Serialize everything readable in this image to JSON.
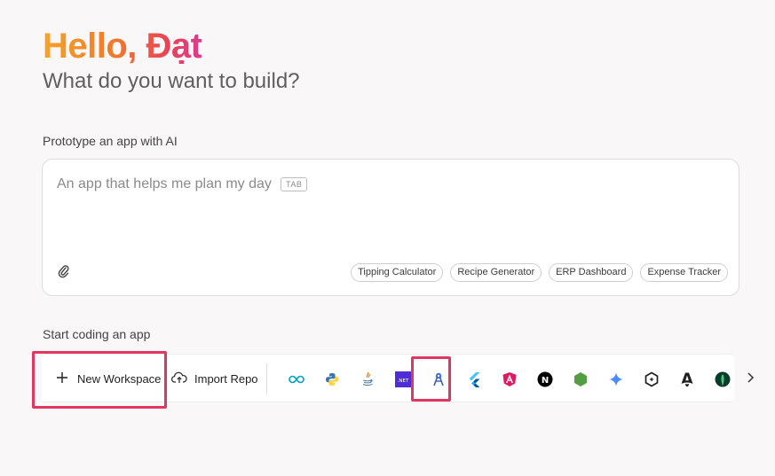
{
  "header": {
    "greeting": "Hello, Đạt",
    "subtitle": "What do you want to build?"
  },
  "prototype": {
    "section_label": "Prototype an app with AI",
    "placeholder": "An app that helps me plan my day",
    "tab_hint": "TAB",
    "attach_icon": "paperclip-icon",
    "suggestions": [
      "Tipping Calculator",
      "Recipe Generator",
      "ERP Dashboard",
      "Expense Tracker"
    ]
  },
  "coding": {
    "section_label": "Start coding an app",
    "new_workspace_label": "New Workspace",
    "import_repo_label": "Import Repo",
    "templates": [
      {
        "name": "arduino",
        "icon": "infinity-icon",
        "color": "#00a3c4"
      },
      {
        "name": "python",
        "icon": "python-icon",
        "color": "#3776ab"
      },
      {
        "name": "java",
        "icon": "java-icon",
        "color": "#e76f00"
      },
      {
        "name": "dotnet",
        "icon": "dotnet-icon",
        "color": "#512bd4",
        "label": ".NET"
      },
      {
        "name": "android-studio",
        "icon": "compass-a-icon",
        "color": "#4285f4"
      },
      {
        "name": "flutter",
        "icon": "flutter-icon",
        "color": "#47c5fb"
      },
      {
        "name": "angular",
        "icon": "angular-icon",
        "color": "#dd1b64"
      },
      {
        "name": "nextjs",
        "icon": "nextjs-icon",
        "color": "#000000",
        "label": "N"
      },
      {
        "name": "nodejs",
        "icon": "nodejs-icon",
        "color": "#539e43"
      },
      {
        "name": "gemini",
        "icon": "sparkle-icon",
        "color": "#4b8cf5"
      },
      {
        "name": "svelte-kit",
        "icon": "hexagon-icon",
        "color": "#1f1f1f"
      },
      {
        "name": "astro",
        "icon": "astro-icon",
        "color": "#1f1f1f"
      },
      {
        "name": "mongodb",
        "icon": "leaf-icon",
        "color": "#13aa52"
      }
    ],
    "next_icon": "chevron-right-icon"
  },
  "colors": {
    "highlight": "#e0365f",
    "background": "#f9f7f8"
  }
}
